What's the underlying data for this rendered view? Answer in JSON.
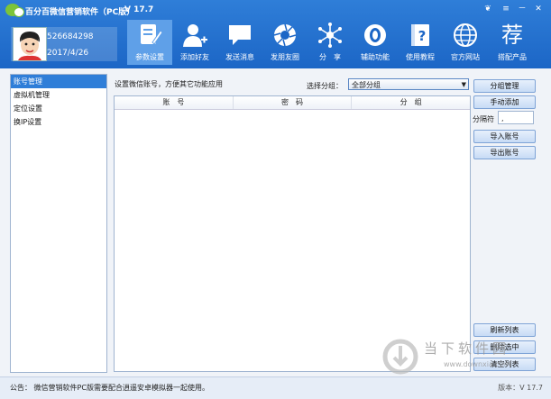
{
  "app": {
    "title": "百分百微信营销软件（PC版）",
    "version": "V 17.7"
  },
  "window_controls": [
    "❦",
    "≡",
    "－",
    "✕"
  ],
  "user": {
    "id": "526684298",
    "date": "2017/4/26"
  },
  "nav": [
    {
      "label": "参数设置",
      "icon": "document-edit-icon",
      "active": true
    },
    {
      "label": "添加好友",
      "icon": "add-user-icon"
    },
    {
      "label": "发送消息",
      "icon": "chat-bubble-icon"
    },
    {
      "label": "发朋友圈",
      "icon": "camera-aperture-icon"
    },
    {
      "label": "分　享",
      "icon": "share-network-icon"
    },
    {
      "label": "辅助功能",
      "icon": "support-icon"
    },
    {
      "label": "使用教程",
      "icon": "help-book-icon"
    },
    {
      "label": "官方网站",
      "icon": "globe-icon"
    },
    {
      "label": "搭配产品",
      "icon": "recommend-char-icon",
      "glyph": "荐"
    }
  ],
  "sidebar": {
    "items": [
      "账号管理",
      "虚拟机管理",
      "定位设置",
      "换IP设置"
    ]
  },
  "panel": {
    "title": "设置微信账号，方便其它功能应用",
    "group_label": "选择分组：",
    "group_selected": "全部分组",
    "columns": [
      "账　号",
      "密　码",
      "分　组"
    ]
  },
  "buttons": {
    "group_manage": "分组管理",
    "manual_add": "手动添加",
    "separator_label": "分隔符",
    "separator_value": ",",
    "import": "导入账号",
    "export": "导出账号",
    "refresh": "刷新列表",
    "delete_selected": "删除选中",
    "clear": "清空列表"
  },
  "status": {
    "notice": "公告：  微信营销软件PC版需要配合逍遥安卓模拟器一起使用。",
    "version": "版本：V 17.7"
  },
  "watermark": {
    "text": "当下软件园",
    "url": "www.downxia.com"
  },
  "colors": {
    "header": "#1c66c6",
    "nav_active": "#5fa0e8",
    "button": "#c7dbf5"
  }
}
